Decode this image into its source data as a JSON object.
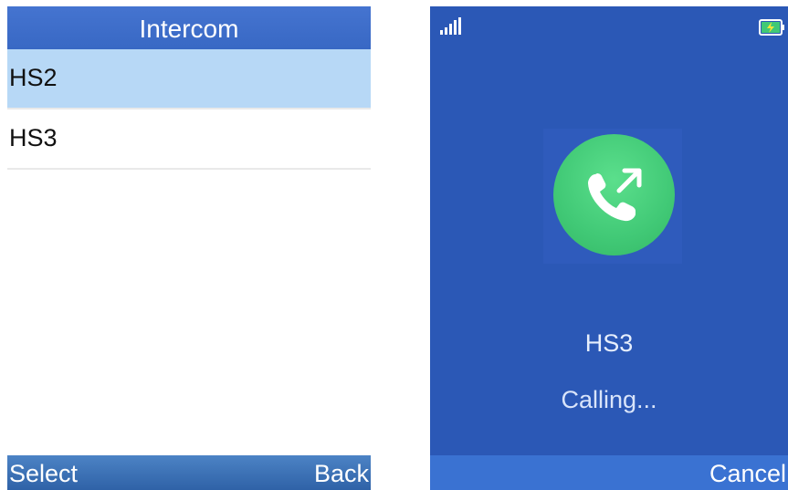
{
  "intercom_screen": {
    "title": "Intercom",
    "items": [
      {
        "label": "HS2",
        "selected": true
      },
      {
        "label": "HS3",
        "selected": false
      }
    ],
    "softkeys": {
      "left": "Select",
      "right": "Back"
    }
  },
  "calling_screen": {
    "status_icons": {
      "signal": "signal-strength-icon",
      "battery": "battery-charging-icon"
    },
    "call_icon": "outgoing-call-icon",
    "callee": "HS3",
    "status": "Calling...",
    "softkeys": {
      "right": "Cancel"
    }
  },
  "colors": {
    "title_bar": "#3c6cc8",
    "selected_row": "#b7d8f6",
    "calling_background": "#2b58b6",
    "call_icon_green": "#41c976",
    "softkey_bar": "#3a72d2"
  }
}
